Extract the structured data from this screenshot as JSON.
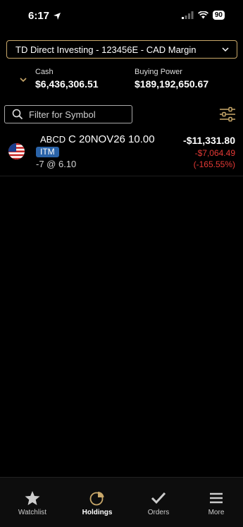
{
  "status_bar": {
    "time": "6:17",
    "battery": "90"
  },
  "account": {
    "label": "TD Direct Investing - 123456E - CAD Margin"
  },
  "balances": {
    "cash_label": "Cash",
    "cash_value": "$6,436,306.51",
    "buying_power_label": "Buying Power",
    "buying_power_value": "$189,192,650.67"
  },
  "filter": {
    "placeholder": "Filter for Symbol"
  },
  "holdings": [
    {
      "symbol": "ABCD",
      "contract": "C 20NOV26 10.00",
      "badge": "ITM",
      "quantity": "-7 @ 6.10",
      "market_value": "-$11,331.80",
      "pl": "-$7,064.49",
      "pl_pct": "(-165.55%)",
      "flag": "us-flag-icon"
    }
  ],
  "tabs": [
    {
      "label": "Watchlist",
      "icon": "star-icon"
    },
    {
      "label": "Holdings",
      "icon": "pie-chart-icon"
    },
    {
      "label": "Orders",
      "icon": "checkmark-icon"
    },
    {
      "label": "More",
      "icon": "menu-icon"
    }
  ],
  "colors": {
    "accent": "#c9a86a",
    "negative": "#e53935",
    "badge": "#2a63a8",
    "background": "#000000"
  }
}
